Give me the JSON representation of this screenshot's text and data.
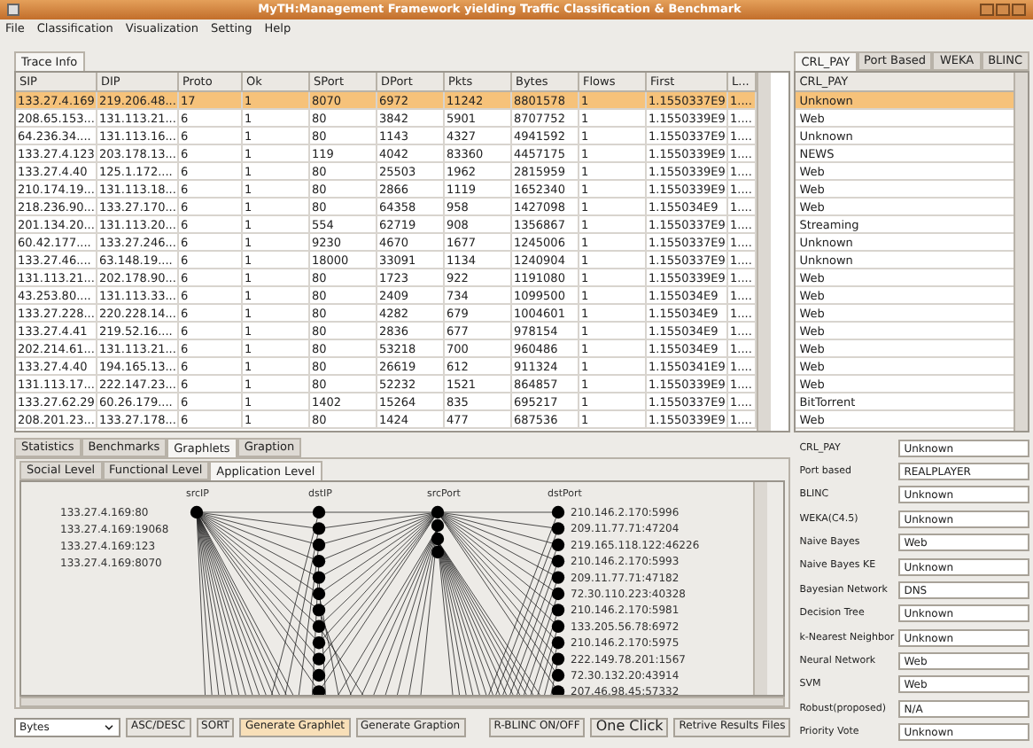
{
  "window": {
    "title": "MyTH:Management Framework yielding Traffic Classification & Benchmark"
  },
  "menu": [
    "File",
    "Classification",
    "Visualization",
    "Setting",
    "Help"
  ],
  "trace_tab": {
    "label": "Trace Info",
    "selected": true
  },
  "table": {
    "columns": [
      "SIP",
      "DIP",
      "Proto",
      "Ok",
      "SPort",
      "DPort",
      "Pkts",
      "Bytes",
      "Flows",
      "First",
      "L..."
    ],
    "rows": [
      {
        "selected": true,
        "cells": [
          "133.27.4.169",
          "219.206.48....",
          "17",
          "1",
          "8070",
          "6972",
          "11242",
          "8801578",
          "1",
          "1.1550337E9",
          "1...."
        ]
      },
      {
        "selected": false,
        "cells": [
          "208.65.153...",
          "131.113.21...",
          "6",
          "1",
          "80",
          "3842",
          "5901",
          "8707752",
          "1",
          "1.1550339E9",
          "1...."
        ]
      },
      {
        "selected": false,
        "cells": [
          "64.236.34....",
          "131.113.16...",
          "6",
          "1",
          "80",
          "1143",
          "4327",
          "4941592",
          "1",
          "1.1550337E9",
          "1...."
        ]
      },
      {
        "selected": false,
        "cells": [
          "133.27.4.123",
          "203.178.13...",
          "6",
          "1",
          "119",
          "4042",
          "83360",
          "4457175",
          "1",
          "1.1550339E9",
          "1...."
        ]
      },
      {
        "selected": false,
        "cells": [
          "133.27.4.40",
          "125.1.172....",
          "6",
          "1",
          "80",
          "25503",
          "1962",
          "2815959",
          "1",
          "1.1550339E9",
          "1...."
        ]
      },
      {
        "selected": false,
        "cells": [
          "210.174.19...",
          "131.113.18...",
          "6",
          "1",
          "80",
          "2866",
          "1119",
          "1652340",
          "1",
          "1.1550339E9",
          "1...."
        ]
      },
      {
        "selected": false,
        "cells": [
          "218.236.90...",
          "133.27.170...",
          "6",
          "1",
          "80",
          "64358",
          "958",
          "1427098",
          "1",
          "1.155034E9",
          "1...."
        ]
      },
      {
        "selected": false,
        "cells": [
          "201.134.20...",
          "131.113.20...",
          "6",
          "1",
          "554",
          "62719",
          "908",
          "1356867",
          "1",
          "1.1550337E9",
          "1...."
        ]
      },
      {
        "selected": false,
        "cells": [
          "60.42.177....",
          "133.27.246...",
          "6",
          "1",
          "9230",
          "4670",
          "1677",
          "1245006",
          "1",
          "1.1550337E9",
          "1...."
        ]
      },
      {
        "selected": false,
        "cells": [
          "133.27.46....",
          "63.148.19....",
          "6",
          "1",
          "18000",
          "33091",
          "1134",
          "1240904",
          "1",
          "1.1550337E9",
          "1...."
        ]
      },
      {
        "selected": false,
        "cells": [
          "131.113.21...",
          "202.178.90...",
          "6",
          "1",
          "80",
          "1723",
          "922",
          "1191080",
          "1",
          "1.1550339E9",
          "1...."
        ]
      },
      {
        "selected": false,
        "cells": [
          "43.253.80....",
          "131.113.33...",
          "6",
          "1",
          "80",
          "2409",
          "734",
          "1099500",
          "1",
          "1.155034E9",
          "1...."
        ]
      },
      {
        "selected": false,
        "cells": [
          "133.27.228...",
          "220.228.14...",
          "6",
          "1",
          "80",
          "4282",
          "679",
          "1004601",
          "1",
          "1.155034E9",
          "1...."
        ]
      },
      {
        "selected": false,
        "cells": [
          "133.27.4.41",
          "219.52.16....",
          "6",
          "1",
          "80",
          "2836",
          "677",
          "978154",
          "1",
          "1.155034E9",
          "1...."
        ]
      },
      {
        "selected": false,
        "cells": [
          "202.214.61...",
          "131.113.21...",
          "6",
          "1",
          "80",
          "53218",
          "700",
          "960486",
          "1",
          "1.155034E9",
          "1...."
        ]
      },
      {
        "selected": false,
        "cells": [
          "133.27.4.40",
          "194.165.13...",
          "6",
          "1",
          "80",
          "26619",
          "612",
          "911324",
          "1",
          "1.1550341E9",
          "1...."
        ]
      },
      {
        "selected": false,
        "cells": [
          "131.113.17...",
          "222.147.23...",
          "6",
          "1",
          "80",
          "52232",
          "1521",
          "864857",
          "1",
          "1.1550339E9",
          "1...."
        ]
      },
      {
        "selected": false,
        "cells": [
          "133.27.62.29",
          "60.26.179....",
          "6",
          "1",
          "1402",
          "15264",
          "835",
          "695217",
          "1",
          "1.1550337E9",
          "1...."
        ]
      },
      {
        "selected": false,
        "cells": [
          "208.201.23...",
          "133.27.178...",
          "6",
          "1",
          "80",
          "1424",
          "477",
          "687536",
          "1",
          "1.1550339E9",
          "1...."
        ]
      }
    ]
  },
  "classifier_tabs": [
    {
      "label": "CRL_PAY",
      "selected": true
    },
    {
      "label": "Port Based",
      "selected": false
    },
    {
      "label": "WEKA",
      "selected": false
    },
    {
      "label": "BLINC",
      "selected": false
    }
  ],
  "classifier_table": {
    "column": "CRL_PAY",
    "rows": [
      {
        "value": "Unknown",
        "selected": true
      },
      {
        "value": "Web",
        "selected": false
      },
      {
        "value": "Unknown",
        "selected": false
      },
      {
        "value": "NEWS",
        "selected": false
      },
      {
        "value": "Web",
        "selected": false
      },
      {
        "value": "Web",
        "selected": false
      },
      {
        "value": "Web",
        "selected": false
      },
      {
        "value": "Streaming",
        "selected": false
      },
      {
        "value": "Unknown",
        "selected": false
      },
      {
        "value": "Unknown",
        "selected": false
      },
      {
        "value": "Web",
        "selected": false
      },
      {
        "value": "Web",
        "selected": false
      },
      {
        "value": "Web",
        "selected": false
      },
      {
        "value": "Web",
        "selected": false
      },
      {
        "value": "Web",
        "selected": false
      },
      {
        "value": "Web",
        "selected": false
      },
      {
        "value": "Web",
        "selected": false
      },
      {
        "value": "BitTorrent",
        "selected": false
      },
      {
        "value": "Web",
        "selected": false
      }
    ]
  },
  "view_tabs": [
    {
      "label": "Statistics",
      "selected": false
    },
    {
      "label": "Benchmarks",
      "selected": false
    },
    {
      "label": "Graphlets",
      "selected": true
    },
    {
      "label": "Graption",
      "selected": false
    }
  ],
  "level_tabs": [
    {
      "label": "Social Level",
      "selected": false
    },
    {
      "label": "Functional Level",
      "selected": false
    },
    {
      "label": "Application Level",
      "selected": true
    }
  ],
  "graphlet": {
    "columns": [
      "srcIP",
      "dstIP",
      "srcPort",
      "dstPort"
    ],
    "source_labels": [
      "133.27.4.169:80",
      "133.27.4.169:19068",
      "133.27.4.169:123",
      "133.27.4.169:8070"
    ],
    "destination_labels": [
      "210.146.2.170:5996",
      "209.11.77.71:47204",
      "219.165.118.122:46226",
      "210.146.2.170:5993",
      "209.11.77.71:47182",
      "72.30.110.223:40328",
      "210.146.2.170:5981",
      "133.205.56.78:6972",
      "210.146.2.170:5975",
      "222.149.78.201:1567",
      "72.30.132.20:43914",
      "207.46.98.45:57332"
    ]
  },
  "results": [
    {
      "label": "CRL_PAY",
      "value": "Unknown"
    },
    {
      "label": "Port based",
      "value": "REALPLAYER"
    },
    {
      "label": "BLINC",
      "value": "Unknown"
    },
    {
      "label": "WEKA(C4.5)",
      "value": "Unknown"
    },
    {
      "label": "Naive Bayes",
      "value": "Web"
    },
    {
      "label": "Naive Bayes KE",
      "value": "Unknown"
    },
    {
      "label": "Bayesian Network",
      "value": "DNS"
    },
    {
      "label": "Decision Tree",
      "value": "Unknown"
    },
    {
      "label": "k-Nearest Neighbor",
      "value": "Unknown"
    },
    {
      "label": "Neural Network",
      "value": "Web"
    },
    {
      "label": "SVM",
      "value": "Web"
    },
    {
      "label": "Robust(proposed)",
      "value": "N/A"
    },
    {
      "label": "Priority Vote",
      "value": "Unknown"
    }
  ],
  "toolbar": {
    "sort_field": "Bytes",
    "buttons": [
      {
        "label": "ASC/DESC",
        "highlighted": false
      },
      {
        "label": "SORT",
        "highlighted": false
      },
      {
        "label": "Generate Graphlet",
        "highlighted": true
      },
      {
        "label": "Generate Graption",
        "highlighted": false
      }
    ],
    "right_buttons": [
      {
        "label": "R-BLINC ON/OFF",
        "kind": "small"
      },
      {
        "label": "One Click",
        "kind": "large"
      },
      {
        "label": "Retrive Results Files",
        "kind": "small"
      }
    ]
  }
}
